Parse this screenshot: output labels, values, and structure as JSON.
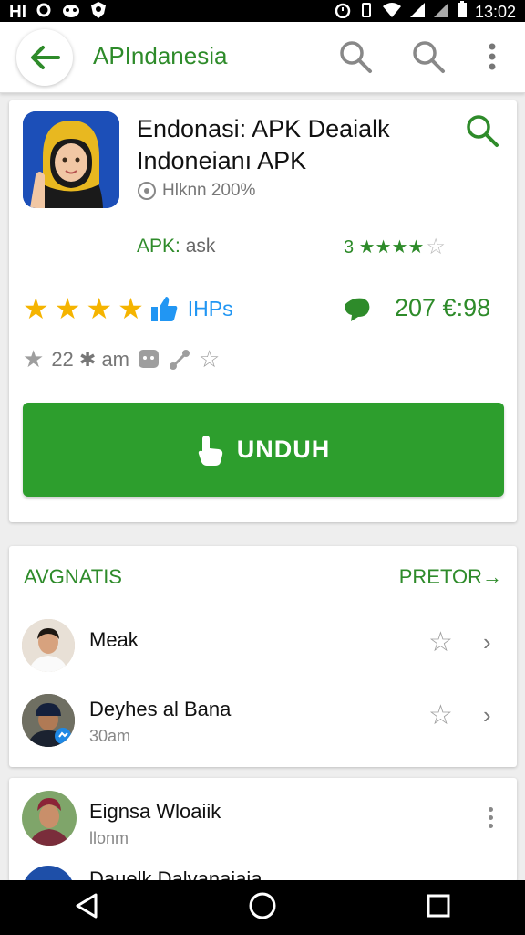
{
  "status_bar": {
    "left_text": "HI",
    "left_icons": [
      "sync-icon",
      "cat-icon",
      "shield-icon"
    ],
    "right_icons": [
      "alarm-icon",
      "vibrate-icon",
      "wifi-icon",
      "signal-icon",
      "battery-icon"
    ],
    "time": "13:02"
  },
  "app_bar": {
    "title": "APIndanesia",
    "icons": [
      "back-arrow-icon",
      "search-icon",
      "search-icon",
      "more-vert-icon"
    ]
  },
  "app_card": {
    "name_line1": "Endonasi: APK Deaialk",
    "name_line2": "Indoneianı APK",
    "meta": "Hlknn 200%",
    "apk_label_prefix": "APK:",
    "apk_label_value": "ask",
    "green_rating": "3 ★★★★",
    "rating_stars": 4,
    "ihps_label": "IHPs",
    "count_right": "207 €:98",
    "stats_text": "22 ✱ am",
    "download_label": "UNDUH"
  },
  "section": {
    "title": "AVGNATIS",
    "more": "PRETOR→",
    "items": [
      {
        "name": "Meak",
        "sub": ""
      },
      {
        "name": "Deyhes al Bana",
        "sub": "30am"
      }
    ]
  },
  "section2": {
    "items": [
      {
        "name": "Eignsa Wloaiik",
        "sub": "llonm"
      },
      {
        "name": "Dauelk Dalvanaiaia",
        "sub": ""
      }
    ]
  },
  "colors": {
    "brand_green": "#2e8b2a",
    "button_green": "#2d9e2d",
    "star_gold": "#f5b400",
    "link_blue": "#2196f3"
  }
}
